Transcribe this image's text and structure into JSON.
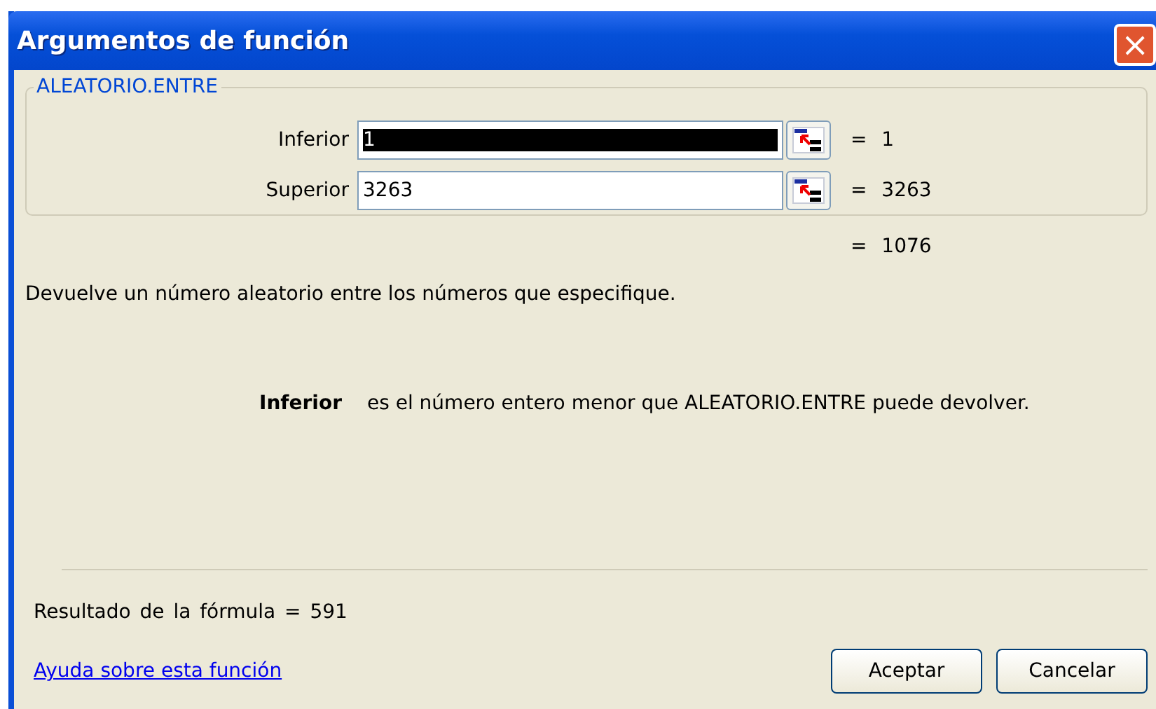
{
  "window": {
    "title": "Argumentos de función",
    "close": "×"
  },
  "group": {
    "title": "ALEATORIO.ENTRE",
    "arguments": [
      {
        "label": "Inferior",
        "value": "1",
        "selected": true,
        "result": "= 1"
      },
      {
        "label": "Superior",
        "value": "3263",
        "selected": false,
        "result": "= 3263"
      }
    ]
  },
  "function_result": "= 1076",
  "description": "Devuelve un número aleatorio entre los números que especifique.",
  "argument_help": {
    "name": "Inferior",
    "text": "es el número entero menor que ALEATORIO.ENTRE puede devolver."
  },
  "formula_result": {
    "label": "Resultado de la fórmula =",
    "value": "591"
  },
  "help_link": "Ayuda sobre esta función",
  "buttons": [
    "Aceptar",
    "Cancelar"
  ]
}
